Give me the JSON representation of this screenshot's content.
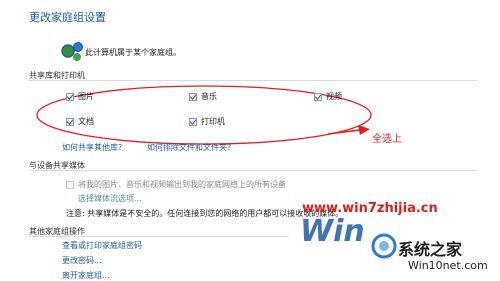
{
  "header": {
    "title": "更改家庭组设置"
  },
  "homegroup": {
    "description": "此计算机属于某个家庭组。",
    "icon": "homegroup-globe-icon"
  },
  "libraries": {
    "section_label": "共享库和打印机",
    "items": [
      {
        "label": "图片",
        "checked": true
      },
      {
        "label": "音乐",
        "checked": true
      },
      {
        "label": "视频",
        "checked": true
      },
      {
        "label": "文档",
        "checked": true
      },
      {
        "label": "打印机",
        "checked": true
      }
    ],
    "links": [
      "如何共享其他库?",
      "如何排除文件和文件夹?"
    ]
  },
  "annotation": {
    "text": "全选上",
    "color": "#e02020"
  },
  "media": {
    "section_label": "与设备共享媒体",
    "stream_label": "将我的图片、音乐和视频输出到我的家庭网络上的所有设备",
    "stream_checked": false,
    "choose_link": "选择媒体流选项...",
    "note": "注意: 共享媒体是不安全的。任何连接到您的网络的用户都可以接收收的媒体。"
  },
  "other": {
    "section_label": "其他家庭组操作",
    "links": [
      "查看或打印家庭组密码",
      "更改密码...",
      "离开家庭组..."
    ]
  },
  "watermark": {
    "site1": "www.win7zhijia.cn",
    "logo": "Win",
    "brand": "系统之家",
    "site2": "Win10net.com"
  },
  "colors": {
    "link": "#1f5fa6",
    "annotation": "#e02020",
    "watermark_red": "#d62020"
  }
}
